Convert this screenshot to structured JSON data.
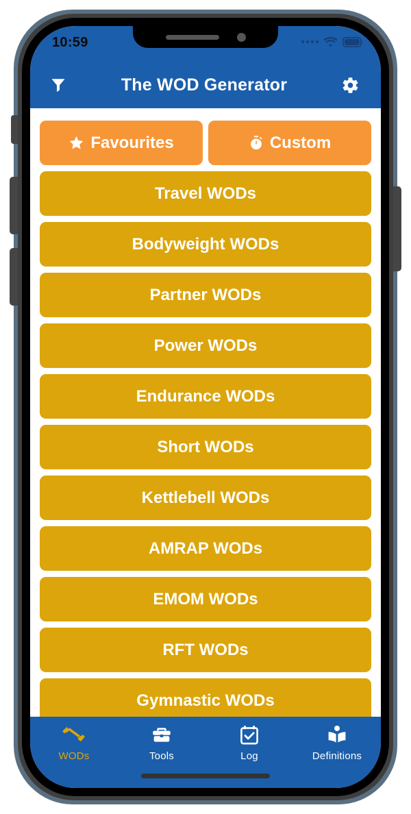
{
  "device": {
    "frame": "iphone-x",
    "notch": true,
    "home_indicator": true
  },
  "status_bar": {
    "time": "10:59",
    "signal_icon": "signal-dots-icon",
    "wifi_icon": "wifi-icon",
    "battery_icon": "battery-full-icon"
  },
  "header": {
    "title": "The WOD Generator",
    "left_icon": "filter-icon",
    "right_icon": "gear-icon",
    "background_color": "#1b5eab",
    "text_color": "#ffffff"
  },
  "main": {
    "quick_actions": [
      {
        "label": "Favourites",
        "icon": "star-icon",
        "color": "#f79637"
      },
      {
        "label": "Custom",
        "icon": "stopwatch-icon",
        "color": "#f79637"
      }
    ],
    "categories": [
      {
        "label": "Travel WODs"
      },
      {
        "label": "Bodyweight WODs"
      },
      {
        "label": "Partner WODs"
      },
      {
        "label": "Power WODs"
      },
      {
        "label": "Endurance WODs"
      },
      {
        "label": "Short WODs"
      },
      {
        "label": "Kettlebell WODs"
      },
      {
        "label": "AMRAP WODs"
      },
      {
        "label": "EMOM WODs"
      },
      {
        "label": "RFT WODs"
      },
      {
        "label": "Gymnastic WODs"
      },
      {
        "label": ""
      }
    ],
    "category_color": "#dca50b",
    "category_text_color": "#ffffff"
  },
  "tab_bar": {
    "background_color": "#1b5eab",
    "active_color": "#dca50b",
    "inactive_color": "#ffffff",
    "tabs": [
      {
        "label": "WODs",
        "icon": "dumbbell-icon",
        "active": true
      },
      {
        "label": "Tools",
        "icon": "toolbox-icon",
        "active": false
      },
      {
        "label": "Log",
        "icon": "calendar-check-icon",
        "active": false
      },
      {
        "label": "Definitions",
        "icon": "open-book-icon",
        "active": false
      }
    ]
  }
}
